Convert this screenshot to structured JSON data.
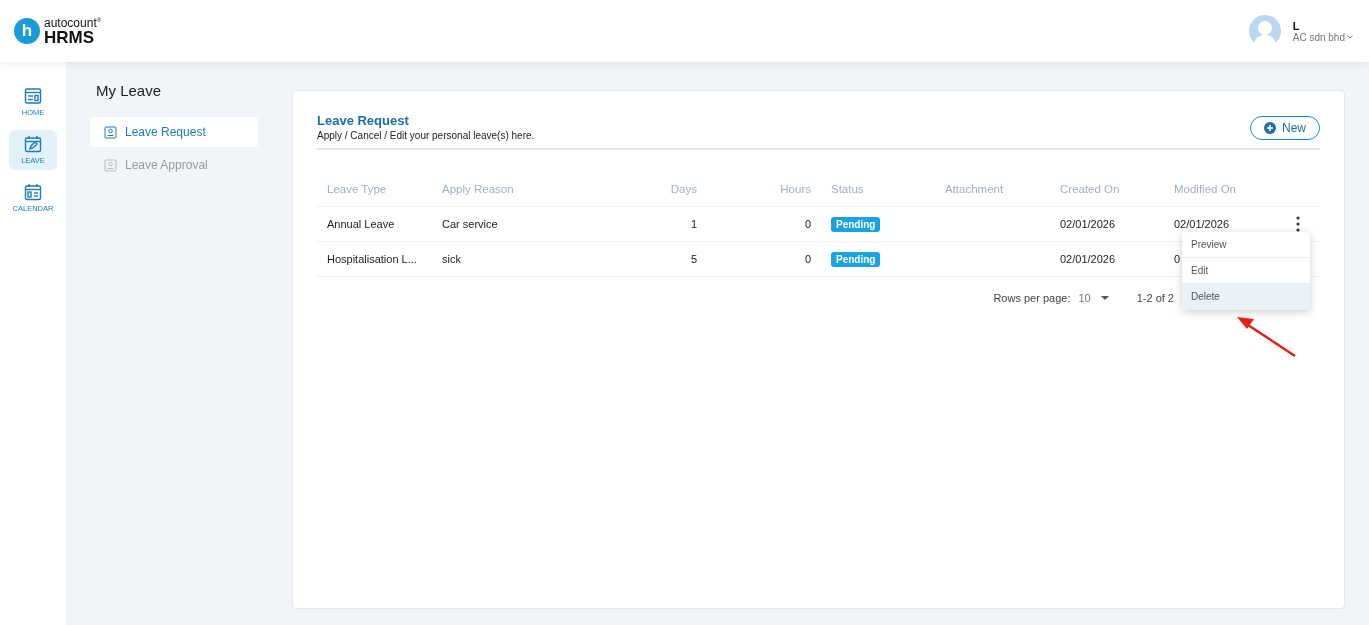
{
  "header": {
    "logo": {
      "mark": "h",
      "brand": "autocount$^{®}$",
      "product": "HRMS"
    },
    "user": {
      "name": "L",
      "company": "AC sdn bhd"
    }
  },
  "rail": [
    {
      "label": "HOME",
      "kind": "home",
      "selected": false
    },
    {
      "label": "LEAVE",
      "kind": "leave",
      "selected": true
    },
    {
      "label": "CALENDAR",
      "kind": "calendar",
      "selected": false
    }
  ],
  "page_title": "My Leave",
  "subnav": [
    {
      "label": "Leave Request",
      "selected": true
    },
    {
      "label": "Leave Approval",
      "selected": false
    }
  ],
  "card": {
    "title": "Leave Request",
    "subtitle": "Apply / Cancel / Edit your personal leave(s) here.",
    "new_button": "New"
  },
  "table": {
    "columns": [
      {
        "label": "Leave Type",
        "kind": "text"
      },
      {
        "label": "Apply Reason",
        "kind": "text"
      },
      {
        "label": "Days",
        "kind": "number"
      },
      {
        "label": "Hours",
        "kind": "number"
      },
      {
        "label": "Status",
        "kind": "status"
      },
      {
        "label": "Attachment",
        "kind": "text"
      },
      {
        "label": "Created On",
        "kind": "text"
      },
      {
        "label": "Modified On",
        "kind": "text"
      }
    ],
    "rows": [
      {
        "cells": [
          "Annual Leave",
          "Car service",
          "1",
          "0",
          "Pending",
          "",
          "02/01/2026",
          "02/01/2026"
        ],
        "menu_open": true
      },
      {
        "cells": [
          "Hospitalisation L...",
          "sick",
          "5",
          "0",
          "Pending",
          "",
          "02/01/2026",
          "0"
        ],
        "menu_open": false
      }
    ]
  },
  "row_menu": {
    "items": [
      {
        "label": "Preview",
        "selected": false
      },
      {
        "label": "Edit",
        "selected": false
      },
      {
        "label": "Delete",
        "selected": true
      }
    ]
  },
  "pagination": {
    "rows_per_page_label": "Rows per page:",
    "rows_per_page": "10",
    "range": "1-2 of 2"
  }
}
